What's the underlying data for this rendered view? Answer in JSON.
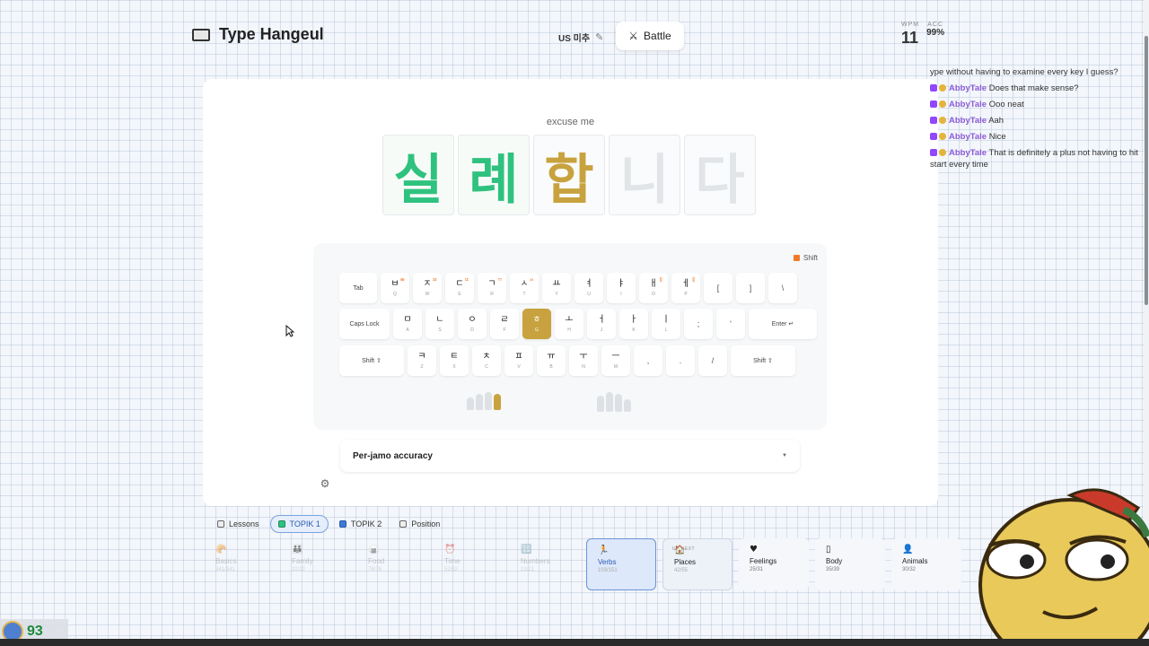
{
  "header": {
    "app_title": "Type Hangeul",
    "layout_label": "US 미추",
    "battle_label": "Battle",
    "wpm_label": "WPM",
    "wpm_value": "11",
    "acc_label": "ACC",
    "acc_value": "99%"
  },
  "prompt": {
    "translation": "excuse me",
    "syllables": [
      {
        "text": "실",
        "state": "done"
      },
      {
        "text": "례",
        "state": "done"
      },
      {
        "text": "합",
        "state": "current"
      },
      {
        "text": "니",
        "state": "pending"
      },
      {
        "text": "다",
        "state": "pending"
      }
    ]
  },
  "keyboard": {
    "shift_legend": "Shift",
    "row1": [
      {
        "label": "Tab"
      },
      {
        "jamo": "ㅂ",
        "latin": "Q",
        "shifted": "ㅃ"
      },
      {
        "jamo": "ㅈ",
        "latin": "W",
        "shifted": "ㅉ"
      },
      {
        "jamo": "ㄷ",
        "latin": "E",
        "shifted": "ㄸ"
      },
      {
        "jamo": "ㄱ",
        "latin": "R",
        "shifted": "ㄲ"
      },
      {
        "jamo": "ㅅ",
        "latin": "T",
        "shifted": "ㅆ"
      },
      {
        "jamo": "ㅛ",
        "latin": "Y"
      },
      {
        "jamo": "ㅕ",
        "latin": "U"
      },
      {
        "jamo": "ㅑ",
        "latin": "I"
      },
      {
        "jamo": "ㅐ",
        "latin": "O",
        "shifted": "ㅒ"
      },
      {
        "jamo": "ㅔ",
        "latin": "P",
        "shifted": "ㅖ"
      },
      {
        "sym": "["
      },
      {
        "sym": "]"
      },
      {
        "sym": "\\"
      }
    ],
    "row2": [
      {
        "label": "Caps Lock"
      },
      {
        "jamo": "ㅁ",
        "latin": "A"
      },
      {
        "jamo": "ㄴ",
        "latin": "S"
      },
      {
        "jamo": "ㅇ",
        "latin": "D"
      },
      {
        "jamo": "ㄹ",
        "latin": "F"
      },
      {
        "jamo": "ㅎ",
        "latin": "G",
        "active": true
      },
      {
        "jamo": "ㅗ",
        "latin": "H"
      },
      {
        "jamo": "ㅓ",
        "latin": "J"
      },
      {
        "jamo": "ㅏ",
        "latin": "K"
      },
      {
        "jamo": "ㅣ",
        "latin": "L"
      },
      {
        "sym": ";"
      },
      {
        "sym": "'"
      },
      {
        "label": "Enter ↵"
      }
    ],
    "row3": [
      {
        "label": "Shift ⇧"
      },
      {
        "jamo": "ㅋ",
        "latin": "Z"
      },
      {
        "jamo": "ㅌ",
        "latin": "X"
      },
      {
        "jamo": "ㅊ",
        "latin": "C"
      },
      {
        "jamo": "ㅍ",
        "latin": "V"
      },
      {
        "jamo": "ㅠ",
        "latin": "B"
      },
      {
        "jamo": "ㅜ",
        "latin": "N"
      },
      {
        "jamo": "ㅡ",
        "latin": "M"
      },
      {
        "sym": ","
      },
      {
        "sym": "."
      },
      {
        "sym": "/"
      },
      {
        "label": "Shift ⇧"
      }
    ]
  },
  "accuracy_dropdown": {
    "label": "Per-jamo accuracy"
  },
  "tabs": [
    {
      "label": "Lessons",
      "active": false
    },
    {
      "label": "TOPIK 1",
      "active": true
    },
    {
      "label": "TOPIK 2",
      "active": false
    },
    {
      "label": "Position",
      "active": false
    }
  ],
  "categories": [
    {
      "icon": "🥐",
      "name": "Basics",
      "count": "341/341",
      "state": "done"
    },
    {
      "icon": "👪",
      "name": "Family",
      "count": "22/22",
      "state": "done"
    },
    {
      "icon": "🍙",
      "name": "Food",
      "count": "76/76",
      "state": "done"
    },
    {
      "icon": "⏰",
      "name": "Time",
      "count": "52/52",
      "state": "done"
    },
    {
      "icon": "🔢",
      "name": "Numbers",
      "count": "21/21",
      "state": "done"
    },
    {
      "icon": "🏃",
      "name": "Verbs",
      "count": "103/151",
      "state": "current"
    },
    {
      "icon": "🏠",
      "name": "Places",
      "count": "42/55",
      "state": "next",
      "badge": "UP NEXT"
    },
    {
      "icon": "♥",
      "name": "Feelings",
      "count": "25/31",
      "state": "plain"
    },
    {
      "icon": "▯",
      "name": "Body",
      "count": "35/39",
      "state": "plain"
    },
    {
      "icon": "👤",
      "name": "Animals",
      "count": "30/32",
      "state": "plain"
    }
  ],
  "chat": [
    {
      "user": "",
      "message": "ype without having to examine every key I guess?"
    },
    {
      "user": "AbbyTale",
      "message": "Does that make sense?"
    },
    {
      "user": "AbbyTale",
      "message": "Ooo neat"
    },
    {
      "user": "AbbyTale",
      "message": "Aah"
    },
    {
      "user": "AbbyTale",
      "message": "Nice"
    },
    {
      "user": "AbbyTale",
      "message": "That is definitely a plus not having to hit start every time"
    }
  ],
  "viewer_count": "93",
  "colors": {
    "done": "#2fc27f",
    "current": "#c8a23e",
    "pending": "#e2e5e8",
    "shift": "#f07a2b",
    "accent_blue": "#2c5bb5",
    "chat_name": "#8b5bd6"
  }
}
